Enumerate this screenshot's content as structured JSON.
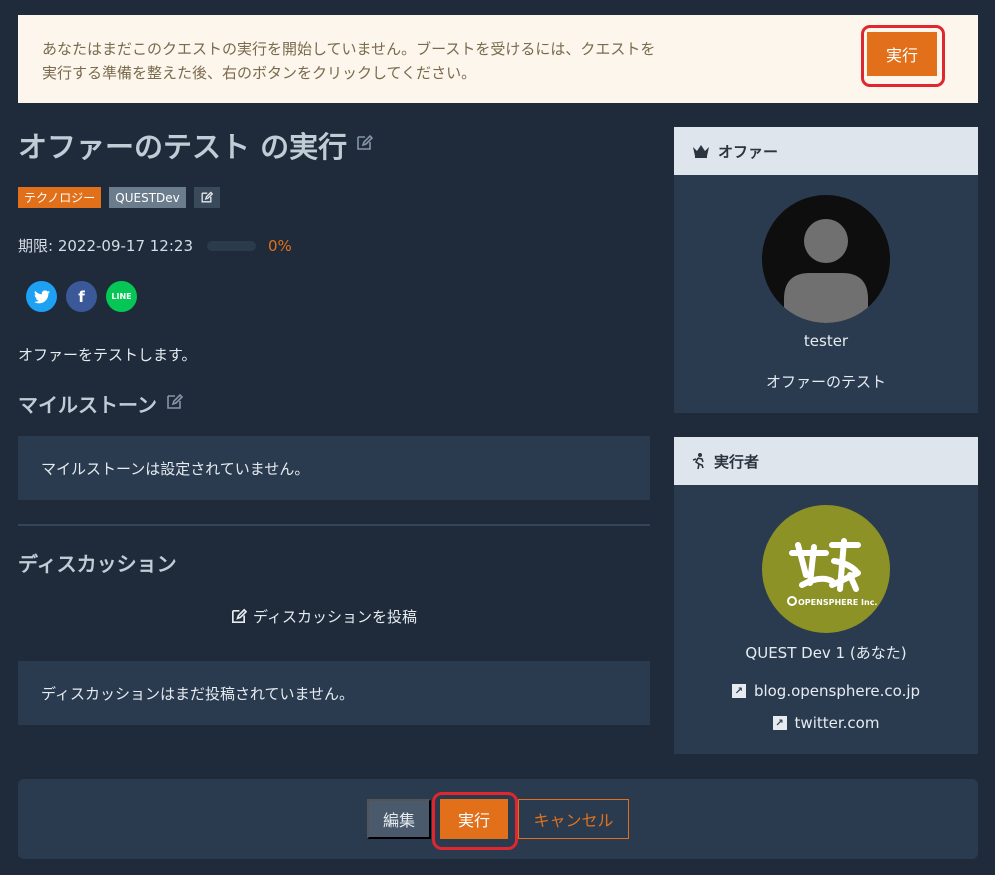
{
  "notice": {
    "line1": "あなたはまだこのクエストの実行を開始していません。ブーストを受けるには、クエストを",
    "line2": "実行する準備を整えた後、右のボタンをクリックしてください。",
    "button": "実行"
  },
  "quest": {
    "title": "オファーのテスト の実行",
    "tags": [
      "テクノロジー",
      "QUESTDev"
    ],
    "deadline": "期限: 2022-09-17 12:23",
    "progress_percent": 0,
    "progress_label": "0%",
    "description": "オファーをテストします。"
  },
  "social": {
    "twitter": "t",
    "facebook": "f",
    "line": "LINE"
  },
  "milestone": {
    "heading": "マイルストーン",
    "empty": "マイルストーンは設定されていません。"
  },
  "discussion": {
    "heading": "ディスカッション",
    "post_link": "ディスカッションを投稿",
    "empty": "ディスカッションはまだ投稿されていません。"
  },
  "offer_card": {
    "heading": "オファー",
    "user": "tester",
    "offer_title": "オファーのテスト"
  },
  "doer_card": {
    "heading": "実行者",
    "user": "QUEST Dev 1 (あなた)",
    "links": [
      "blog.opensphere.co.jp",
      "twitter.com"
    ],
    "logo_text": "OPENSPHERE Inc."
  },
  "footer": {
    "edit": "編集",
    "execute": "実行",
    "cancel": "キャンセル"
  },
  "colors": {
    "accent": "#e2701a",
    "highlight_ring": "#e0262f"
  }
}
